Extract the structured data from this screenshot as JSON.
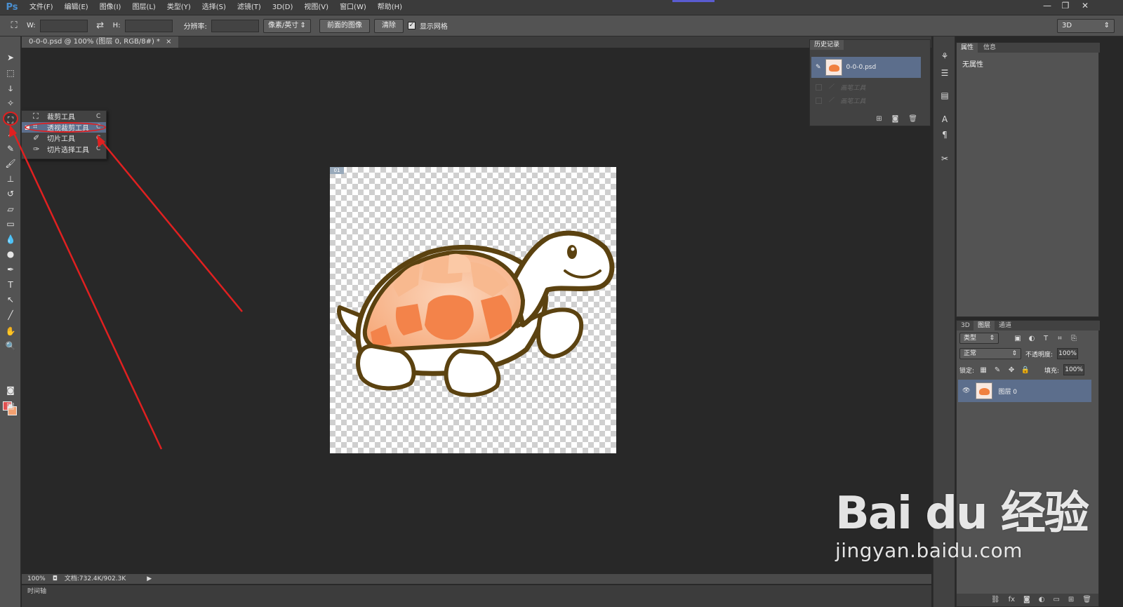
{
  "app": {
    "logo": "Ps"
  },
  "menubar": {
    "items": [
      "文件(F)",
      "编辑(E)",
      "图像(I)",
      "图层(L)",
      "类型(Y)",
      "选择(S)",
      "滤镜(T)",
      "3D(D)",
      "视图(V)",
      "窗口(W)",
      "帮助(H)"
    ]
  },
  "window_controls": {
    "minimize": "—",
    "restore": "❐",
    "close": "✕"
  },
  "options_bar": {
    "width_label": "W:",
    "height_label": "H:",
    "swap_icon": "⇄",
    "resolution_label": "分辨率:",
    "unit_select": "像素/英寸",
    "front_image_button": "前面的图像",
    "clear_button": "清除",
    "show_grid_label": "显示网格",
    "show_grid_checked": true,
    "workspace": "3D"
  },
  "document": {
    "tab_title": "0-0-0.psd @ 100% (图层 0, RGB/8#) *",
    "tab_close": "×",
    "slice_label": "01"
  },
  "tool_flyout": {
    "items": [
      {
        "icon": "crop-icon",
        "label": "裁剪工具",
        "key": "C",
        "selected": false
      },
      {
        "icon": "perspective-crop-icon",
        "label": "透视裁剪工具",
        "key": "C",
        "selected": true
      },
      {
        "icon": "slice-icon",
        "label": "切片工具",
        "key": "C",
        "selected": false
      },
      {
        "icon": "slice-select-icon",
        "label": "切片选择工具",
        "key": "C",
        "selected": false
      }
    ]
  },
  "status_bar": {
    "zoom": "100%",
    "doc_info": "文档:732.4K/902.3K",
    "arrow": "▶"
  },
  "timeline": {
    "tab": "时间轴"
  },
  "history_panel": {
    "tab": "历史记录",
    "snapshot": "0-0-0.psd",
    "items": [
      "画笔工具",
      "画笔工具"
    ]
  },
  "properties_panel": {
    "tabs": [
      "属性",
      "信息"
    ],
    "empty_text": "无属性"
  },
  "layers_panel": {
    "tabs": [
      "3D",
      "图层",
      "通道"
    ],
    "filter_kind": "类型",
    "blend_mode": "正常",
    "opacity_label": "不透明度:",
    "opacity_value": "100%",
    "lock_label": "锁定:",
    "fill_label": "填充:",
    "fill_value": "100%",
    "layer_name": "图层 0"
  },
  "watermark": {
    "brand": "Bai du 经验",
    "url": "jingyan.baidu.com"
  },
  "colors": {
    "foreground": "#e05050",
    "background": "#f3a070",
    "annotation": "#e02020",
    "selection": "#5c6e8c"
  }
}
